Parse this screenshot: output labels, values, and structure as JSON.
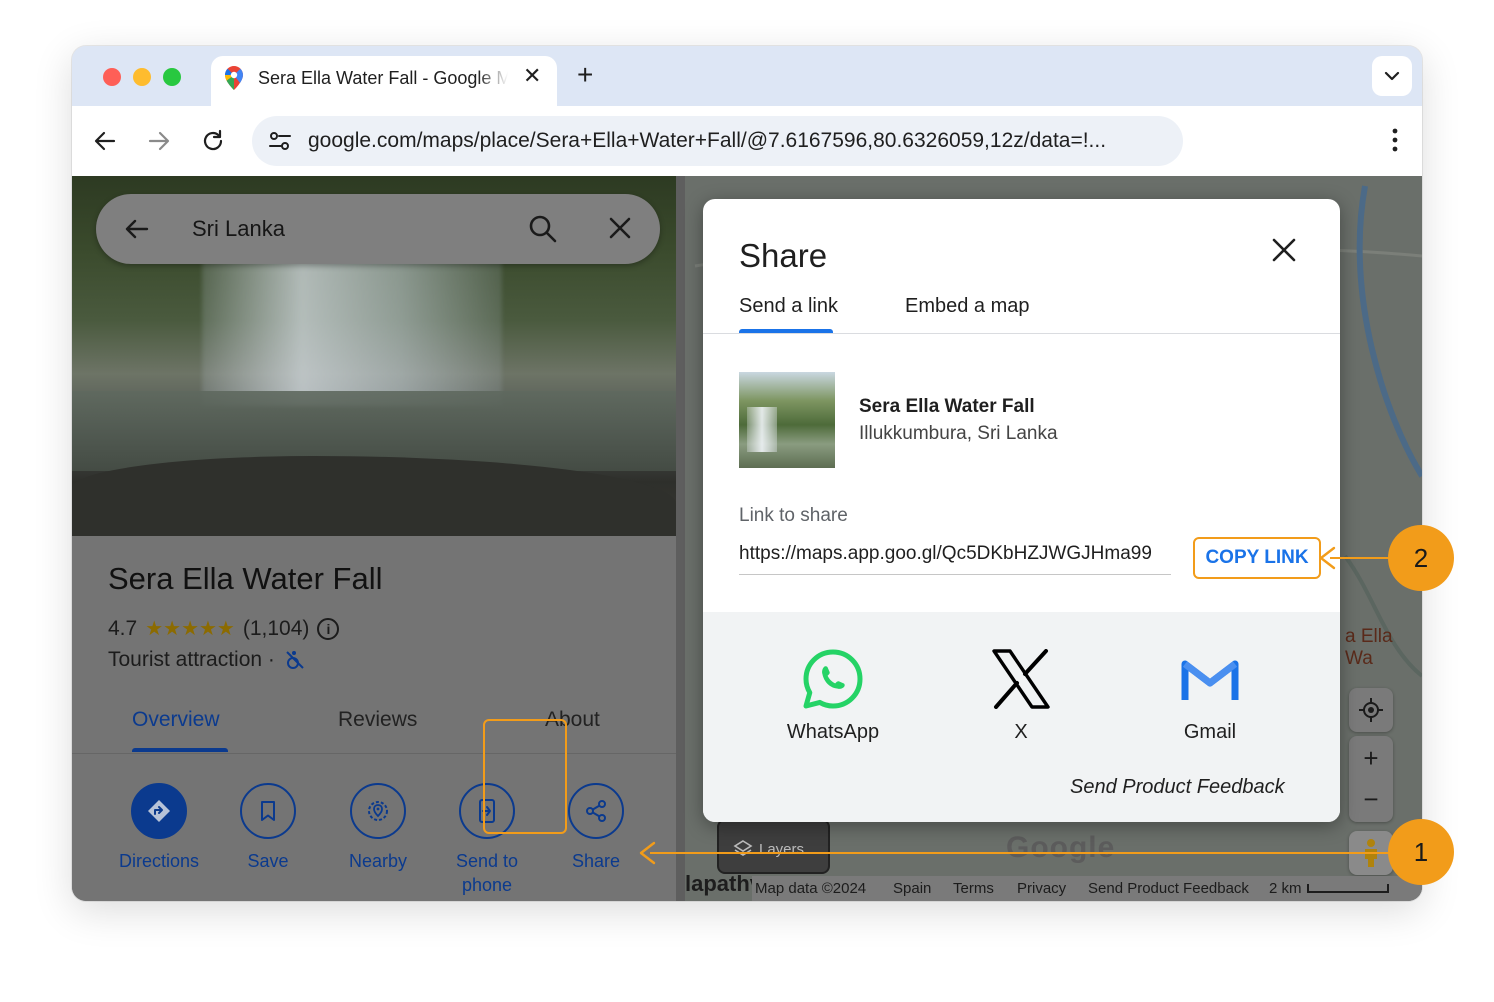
{
  "browser": {
    "tab_title": "Sera Ella Water Fall - Google Maps",
    "new_tab_label": "+",
    "close_tab_label": "✕",
    "url": "google.com/maps/place/Sera+Ella+Water+Fall/@7.6167596,80.6326059,12z/data=!..."
  },
  "search": {
    "query": "Sri Lanka"
  },
  "place": {
    "name": "Sera Ella Water Fall",
    "rating": "4.7",
    "stars": "★★★★★",
    "review_count": "(1,104)",
    "category": "Tourist attraction ·",
    "tabs": [
      "Overview",
      "Reviews",
      "About"
    ],
    "actions": [
      {
        "label": "Directions",
        "icon": "directions-icon"
      },
      {
        "label": "Save",
        "icon": "bookmark-icon"
      },
      {
        "label": "Nearby",
        "icon": "nearby-icon"
      },
      {
        "label": "Send to phone",
        "icon": "send-to-phone-icon"
      },
      {
        "label": "Share",
        "icon": "share-icon"
      }
    ]
  },
  "share_dialog": {
    "title": "Share",
    "tabs": [
      "Send a link",
      "Embed a map"
    ],
    "place_name": "Sera Ella Water Fall",
    "place_address": "Illukkumbura, Sri Lanka",
    "link_label": "Link to share",
    "link_value": "https://maps.app.goo.gl/Qc5DKbHZJWGJHma99",
    "copy_link_label": "COPY LINK",
    "social": [
      {
        "label": "WhatsApp",
        "icon": "whatsapp-icon",
        "color": "#25d366"
      },
      {
        "label": "X",
        "icon": "x-logo-icon",
        "color": "#000000"
      },
      {
        "label": "Gmail",
        "icon": "gmail-icon",
        "color": "#1a73e8"
      }
    ],
    "feedback_label": "Send Product Feedback"
  },
  "map": {
    "layers_label": "Layers",
    "place_label": "a Ella Wa",
    "lapath_label": "lapathv",
    "footer": {
      "map_data": "Map data ©2024",
      "region": "Spain",
      "terms": "Terms",
      "privacy": "Privacy",
      "feedback": "Send Product Feedback",
      "scale": "2 km"
    }
  },
  "callouts": {
    "step1": "1",
    "step2": "2"
  },
  "colors": {
    "accent": "#1a73e8",
    "highlight": "#f29c1a",
    "maps_blue_dim": "#0b3a8e"
  }
}
